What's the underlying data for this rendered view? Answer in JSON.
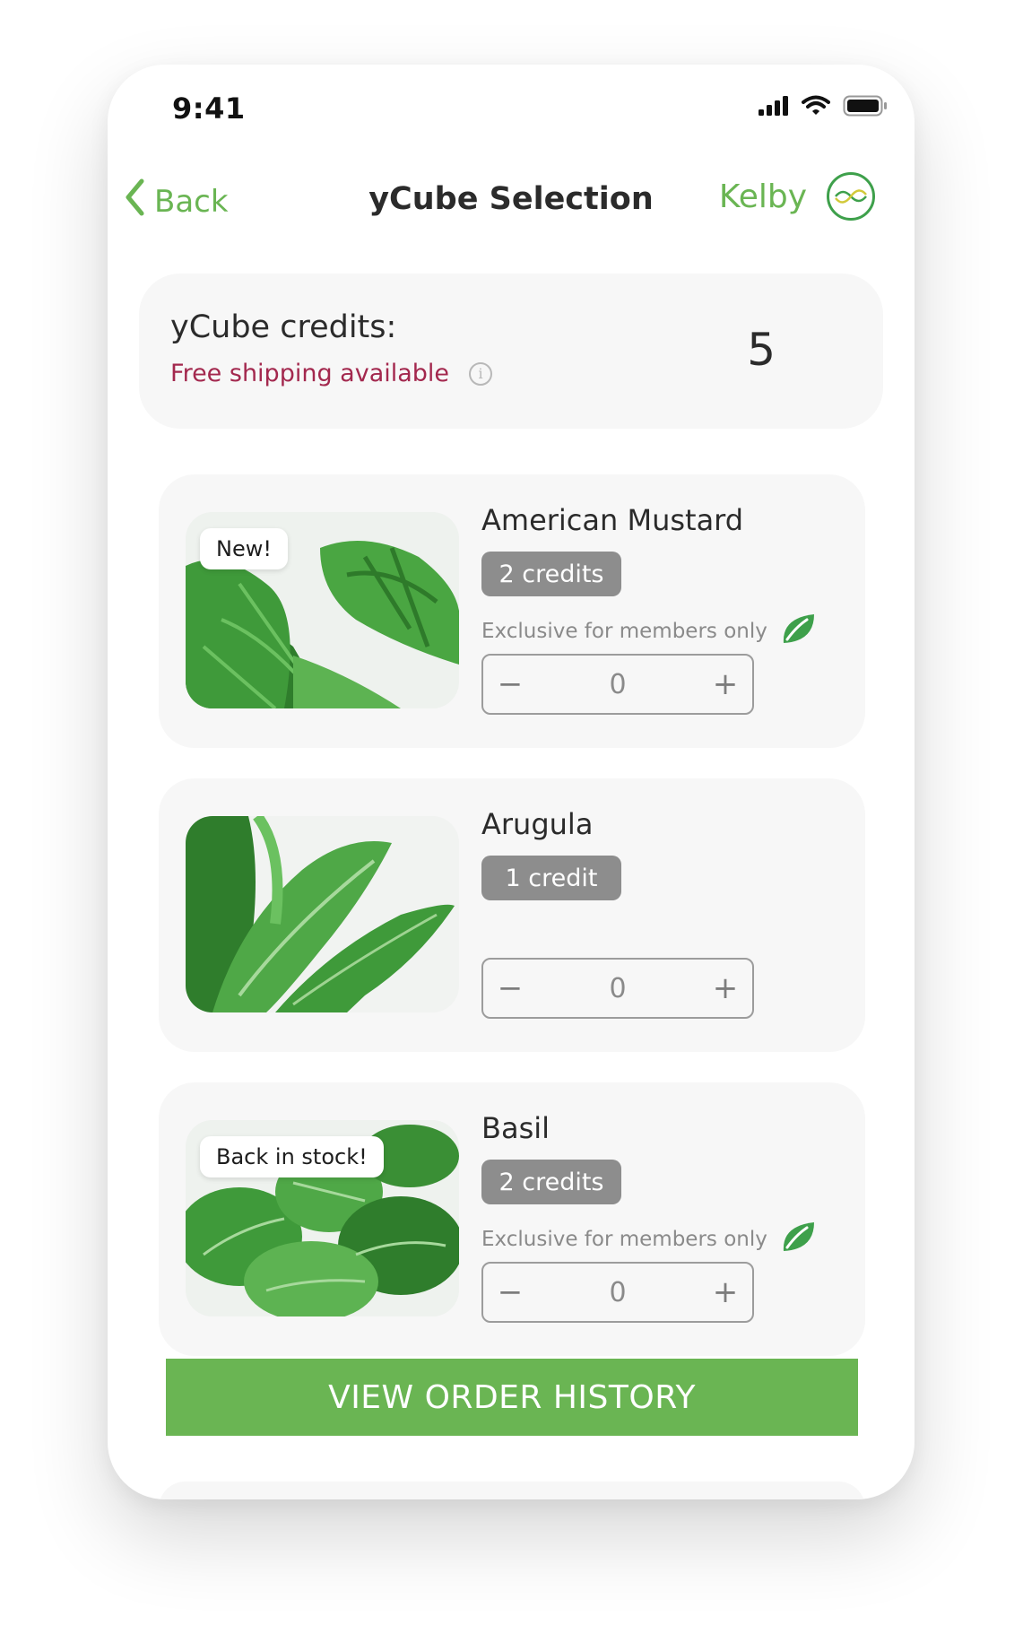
{
  "status_bar": {
    "time": "9:41",
    "icons": [
      "cellular-signal-icon",
      "wifi-icon",
      "battery-icon"
    ]
  },
  "nav": {
    "back_label": "Back",
    "title": "yCube Selection",
    "user_name": "Kelby",
    "logo_icon": "brand-logo-icon"
  },
  "credits": {
    "label": "yCube credits:",
    "shipping": "Free shipping available",
    "value": "5"
  },
  "products": [
    {
      "badge": "New!",
      "name": "American Mustard",
      "credits": "2 credits",
      "exclusive": "Exclusive for members only",
      "quantity": "0"
    },
    {
      "badge": "",
      "name": "Arugula",
      "credits": "1 credit",
      "exclusive": "",
      "quantity": "0"
    },
    {
      "badge": "Back in stock!",
      "name": "Basil",
      "credits": "2 credits",
      "exclusive": "Exclusive for members only",
      "quantity": "0"
    }
  ],
  "stepper": {
    "minus": "−",
    "plus": "+"
  },
  "order_history_label": "VIEW ORDER HISTORY",
  "colors": {
    "accent_green": "#6ab553",
    "shipping_text": "#a3284e",
    "credit_badge": "#8d8d8d",
    "card_bg": "#f7f7f7"
  }
}
